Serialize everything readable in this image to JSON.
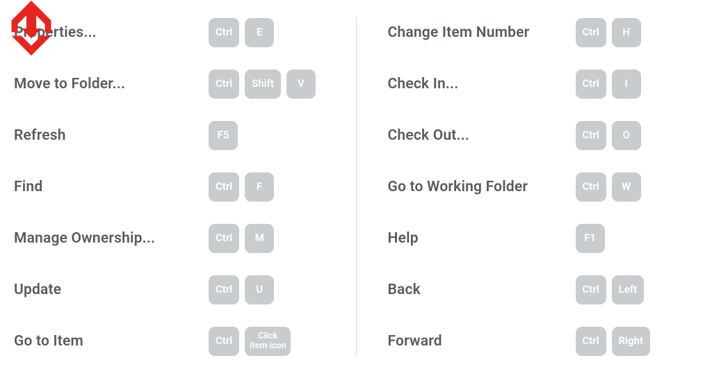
{
  "left": [
    {
      "label": "Properties...",
      "keys": [
        "Ctrl",
        "E"
      ]
    },
    {
      "label": "Move to Folder...",
      "keys": [
        "Ctrl",
        "Shift",
        "V"
      ]
    },
    {
      "label": "Refresh",
      "keys": [
        "F5"
      ]
    },
    {
      "label": "Find",
      "keys": [
        "Ctrl",
        "F"
      ]
    },
    {
      "label": "Manage Ownership...",
      "keys": [
        "Ctrl",
        "M"
      ]
    },
    {
      "label": "Update",
      "keys": [
        "Ctrl",
        "U"
      ]
    },
    {
      "label": "Go to Item",
      "keys": [
        "Ctrl",
        "Click\nItem icon"
      ]
    }
  ],
  "right": [
    {
      "label": "Change Item Number",
      "keys": [
        "Ctrl",
        "H"
      ]
    },
    {
      "label": "Check In...",
      "keys": [
        "Ctrl",
        "I"
      ]
    },
    {
      "label": "Check Out...",
      "keys": [
        "Ctrl",
        "O"
      ]
    },
    {
      "label": "Go to Working Folder",
      "keys": [
        "Ctrl",
        "W"
      ]
    },
    {
      "label": "Help",
      "keys": [
        "F1"
      ]
    },
    {
      "label": "Back",
      "keys": [
        "Ctrl",
        "Left"
      ]
    },
    {
      "label": "Forward",
      "keys": [
        "Ctrl",
        "Right"
      ]
    }
  ]
}
